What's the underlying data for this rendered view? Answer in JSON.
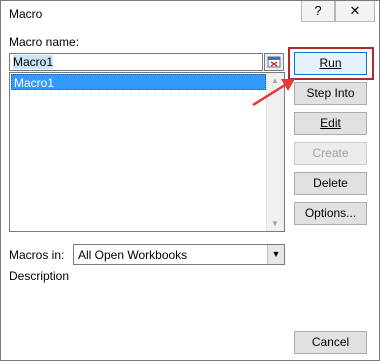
{
  "window": {
    "title": "Macro",
    "help_glyph": "?",
    "close_glyph": "✕"
  },
  "macro_name": {
    "label": "Macro name:",
    "value": "Macro1",
    "list_items": [
      "Macro1"
    ]
  },
  "macros_in": {
    "label": "Macros in:",
    "selected": "All Open Workbooks"
  },
  "description": {
    "label": "Description"
  },
  "buttons": {
    "run": "Run",
    "step_into": "Step Into",
    "edit": "Edit",
    "create": "Create",
    "delete": "Delete",
    "options": "Options...",
    "cancel": "Cancel"
  },
  "annotation": {
    "highlight_color": "#b5272f",
    "arrow_color": "#e53a3a"
  },
  "icons": [
    "help-icon",
    "close-icon",
    "collapse-dialog-icon",
    "scroll-up-icon",
    "scroll-down-icon",
    "chevron-down-icon"
  ]
}
